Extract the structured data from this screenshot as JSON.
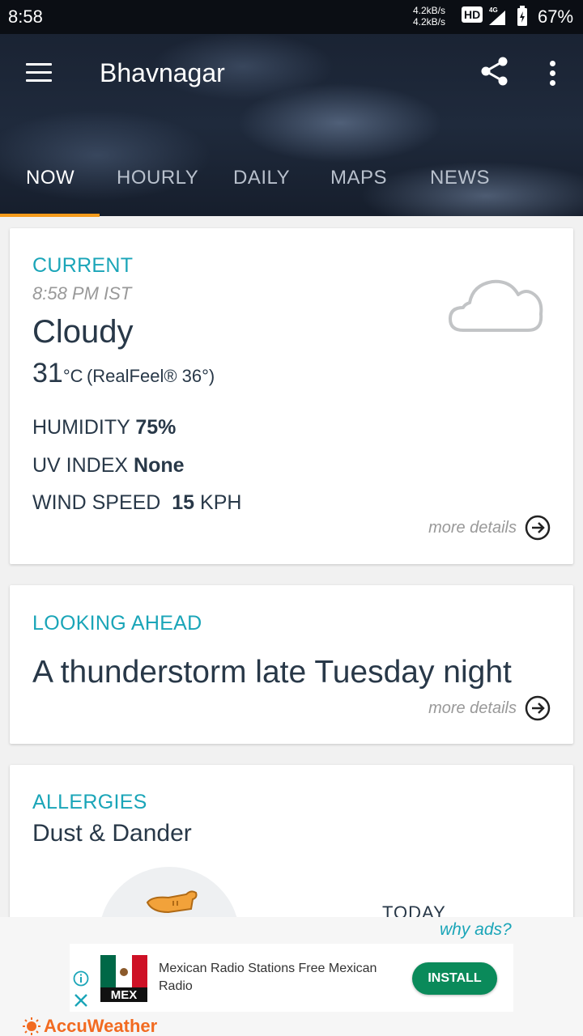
{
  "status_bar": {
    "time": "8:58",
    "speed_up": "4.2kB/s",
    "speed_down": "4.2kB/s",
    "hd": "HD",
    "network": "4G",
    "battery": "67%"
  },
  "header": {
    "title": "Bhavnagar",
    "tabs": [
      {
        "label": "NOW"
      },
      {
        "label": "HOURLY"
      },
      {
        "label": "DAILY"
      },
      {
        "label": "MAPS"
      },
      {
        "label": "NEWS"
      }
    ],
    "active_tab": "NOW",
    "accent_color": "#f59b1b"
  },
  "current": {
    "label": "CURRENT",
    "time": "8:58 PM IST",
    "condition": "Cloudy",
    "temperature": "31",
    "unit": "°C",
    "real_feel": "(RealFeel® 36°)",
    "humidity_label": "HUMIDITY",
    "humidity_value": "75%",
    "uv_label": "UV INDEX",
    "uv_value": "None",
    "wind_label": "WIND SPEED",
    "wind_value": "15",
    "wind_unit": "KPH",
    "more_details": "more details",
    "icon": "cloud-icon"
  },
  "looking_ahead": {
    "label": "LOOKING AHEAD",
    "text": "A thunderstorm late Tuesday night",
    "more_details": "more details"
  },
  "allergies": {
    "label": "ALLERGIES",
    "subtitle": "Dust & Dander",
    "today": "TODAY"
  },
  "ad": {
    "why_ads": "why ads?",
    "logo_text": "MEX",
    "text": "Mexican Radio Stations Free Mexican Radio",
    "install": "INSTALL",
    "brand": "AccuWeather"
  },
  "colors": {
    "label_teal": "#1aa5b8",
    "install_green": "#0a8a5a",
    "brand_orange": "#f26b21"
  }
}
